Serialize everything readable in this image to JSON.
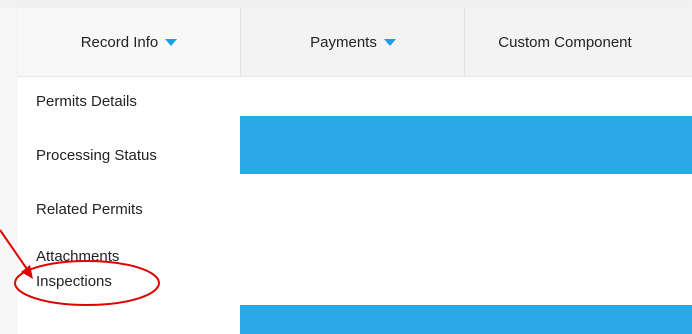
{
  "nav": {
    "record_info": "Record Info",
    "payments": "Payments",
    "custom_component": "Custom Component"
  },
  "menu": {
    "items": [
      "Permits Details",
      "Processing Status",
      "Related Permits",
      "Attachments",
      "Inspections"
    ],
    "highlighted": "Inspections"
  },
  "colors": {
    "accent": "#2aa9e7",
    "caret": "#1e9cec",
    "annotation": "#e00000"
  },
  "icons": {
    "dropdown": "caret-down-icon",
    "annotation_arrow": "arrow-icon"
  }
}
